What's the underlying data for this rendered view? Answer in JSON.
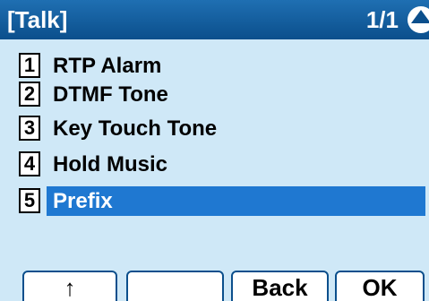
{
  "title_bar": {
    "title": "[Talk]",
    "page_indicator": "1/1"
  },
  "menu": {
    "items": [
      {
        "number": "1",
        "label": "RTP Alarm",
        "selected": false
      },
      {
        "number": "2",
        "label": "DTMF Tone",
        "selected": false
      },
      {
        "number": "3",
        "label": "Key Touch Tone",
        "selected": false
      },
      {
        "number": "4",
        "label": "Hold Music",
        "selected": false
      },
      {
        "number": "5",
        "label": "Prefix",
        "selected": true
      }
    ]
  },
  "softkeys": {
    "key1": "↑",
    "key2": "",
    "key3": "Back",
    "key4": "OK"
  },
  "colors": {
    "title_bar": "#0b4f8c",
    "background": "#cfe8f7",
    "selection": "#1f78d1"
  }
}
